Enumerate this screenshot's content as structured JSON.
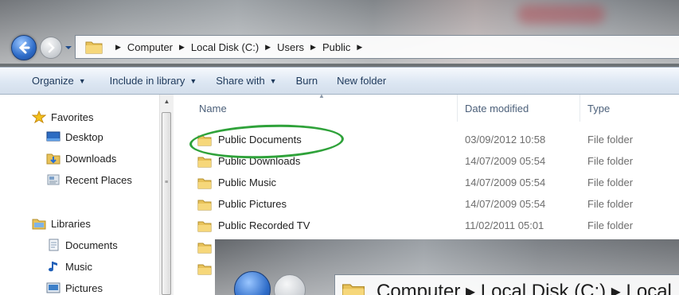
{
  "address_bar": {
    "crumbs": [
      "Computer",
      "Local Disk (C:)",
      "Users",
      "Public"
    ]
  },
  "toolbar": {
    "organize": "Organize",
    "include_in_library": "Include in library",
    "share_with": "Share with",
    "burn": "Burn",
    "new_folder": "New folder"
  },
  "nav_pane": {
    "favorites_label": "Favorites",
    "favorites": [
      "Desktop",
      "Downloads",
      "Recent Places"
    ],
    "libraries_label": "Libraries",
    "libraries": [
      "Documents",
      "Music",
      "Pictures"
    ]
  },
  "file_list": {
    "columns": {
      "name": "Name",
      "date_modified": "Date modified",
      "type": "Type"
    },
    "rows": [
      {
        "name": "Public Documents",
        "date": "03/09/2012 10:58",
        "type": "File folder"
      },
      {
        "name": "Public Downloads",
        "date": "14/07/2009 05:54",
        "type": "File folder"
      },
      {
        "name": "Public Music",
        "date": "14/07/2009 05:54",
        "type": "File folder"
      },
      {
        "name": "Public Pictures",
        "date": "14/07/2009 05:54",
        "type": "File folder"
      },
      {
        "name": "Public Recorded TV",
        "date": "11/02/2011 05:01",
        "type": "File folder"
      }
    ]
  },
  "annotation": {
    "highlight_color": "#2fa23a"
  },
  "overlay": {
    "address_text": "Computer ▸ Local Disk (C:) ▸ Local"
  },
  "icons": [
    "back-icon",
    "forward-icon",
    "folder-icon",
    "star-icon",
    "desktop-icon",
    "downloads-icon",
    "recent-places-icon",
    "library-icon",
    "documents-icon",
    "music-icon",
    "pictures-icon"
  ]
}
